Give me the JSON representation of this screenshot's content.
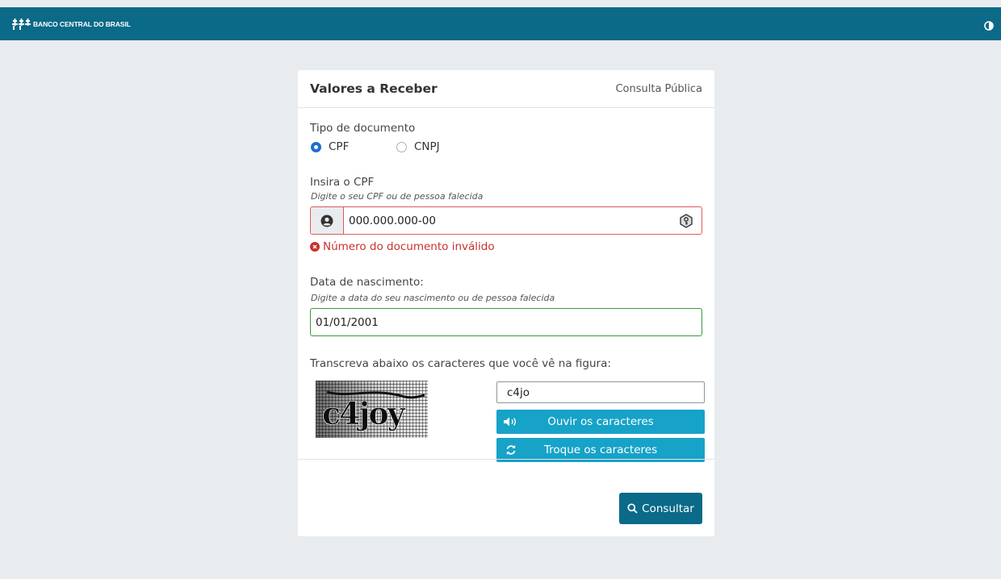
{
  "header": {
    "logo_text": "BANCO CENTRAL DO BRASIL",
    "contrast_icon": "contrast-icon"
  },
  "card": {
    "title": "Valores a Receber",
    "subtitle": "Consulta Pública"
  },
  "doc_type": {
    "label": "Tipo de documento",
    "options": [
      {
        "label": "CPF",
        "selected": true
      },
      {
        "label": "CNPJ",
        "selected": false
      }
    ]
  },
  "cpf": {
    "label": "Insira o CPF",
    "hint": "Digite o seu CPF ou de pessoa falecida",
    "value": "000.000.000-00",
    "error": "Número do documento inválido",
    "status": "invalid"
  },
  "birth": {
    "label": "Data de nascimento:",
    "hint": "Digite a data do seu nascimento ou de pessoa falecida",
    "value": "01/01/2001",
    "status": "valid"
  },
  "captcha": {
    "label": "Transcreva abaixo os caracteres que você vê na figura:",
    "value": "c4jo",
    "image_text": "c4joy",
    "listen_label": "Ouvir os caracteres",
    "refresh_label": "Troque os caracteres"
  },
  "submit_label": "Consultar",
  "colors": {
    "topbar": "#0a6a88",
    "accent_button": "#17a2c8",
    "error": "#c9302c",
    "valid": "#3a9a3a",
    "radio": "#1f6fd1"
  }
}
